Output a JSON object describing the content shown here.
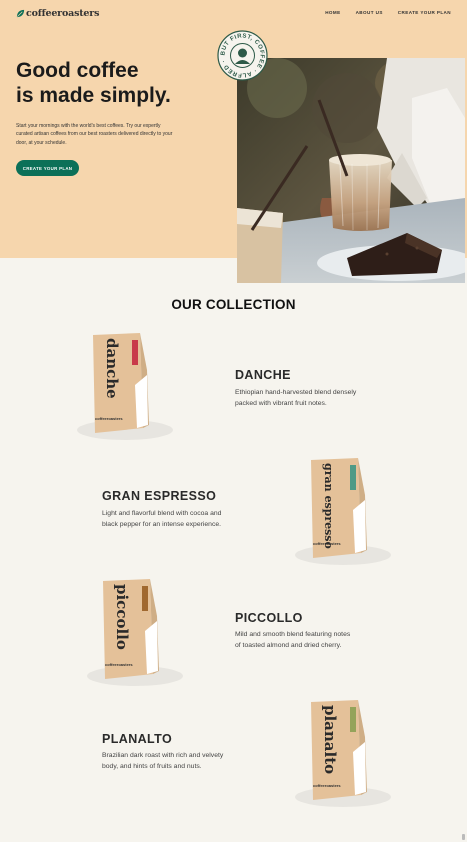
{
  "brand": {
    "name": "coffeeroasters",
    "accent": "#0c7058",
    "hero_bg": "#f6d6ad",
    "page_bg": "#f6f4ee"
  },
  "nav": {
    "items": [
      "HOME",
      "ABOUT US",
      "CREATE YOUR PLAN"
    ]
  },
  "hero": {
    "title_line1": "Good coffee",
    "title_line2": "is made simply.",
    "description": "Start your mornings with the world's best coffees. Try our expertly curated artisan coffees from our best roasters delivered directly to your door, at your schedule.",
    "cta_label": "CREATE YOUR PLAN"
  },
  "badge": {
    "text": "BUT FIRST, COFFEE · ALFRED ·"
  },
  "collection": {
    "title": "OUR COLLECTION",
    "items": [
      {
        "name": "DANCHE",
        "bag_label": "danche",
        "desc_line1": "Ethiopian hand-harvested blend densely",
        "desc_line2": "packed with vibrant fruit notes.",
        "tab_color": "#c83a4a"
      },
      {
        "name": "GRAN ESPRESSO",
        "bag_label": "gran espresso",
        "desc_line1": "Light and flavorful blend with cocoa and",
        "desc_line2": "black pepper for an intense experience.",
        "tab_color": "#4f9a86"
      },
      {
        "name": "PICCOLLO",
        "bag_label": "piccollo",
        "desc_line1": "Mild and smooth blend featuring notes",
        "desc_line2": "of toasted almond and dried cherry.",
        "tab_color": "#a0682f"
      },
      {
        "name": "PLANALTO",
        "bag_label": "planalto",
        "desc_line1": "Brazilian dark roast with rich and velvety",
        "desc_line2": "body, and hints of fruits and nuts.",
        "tab_color": "#94a35a"
      }
    ]
  }
}
